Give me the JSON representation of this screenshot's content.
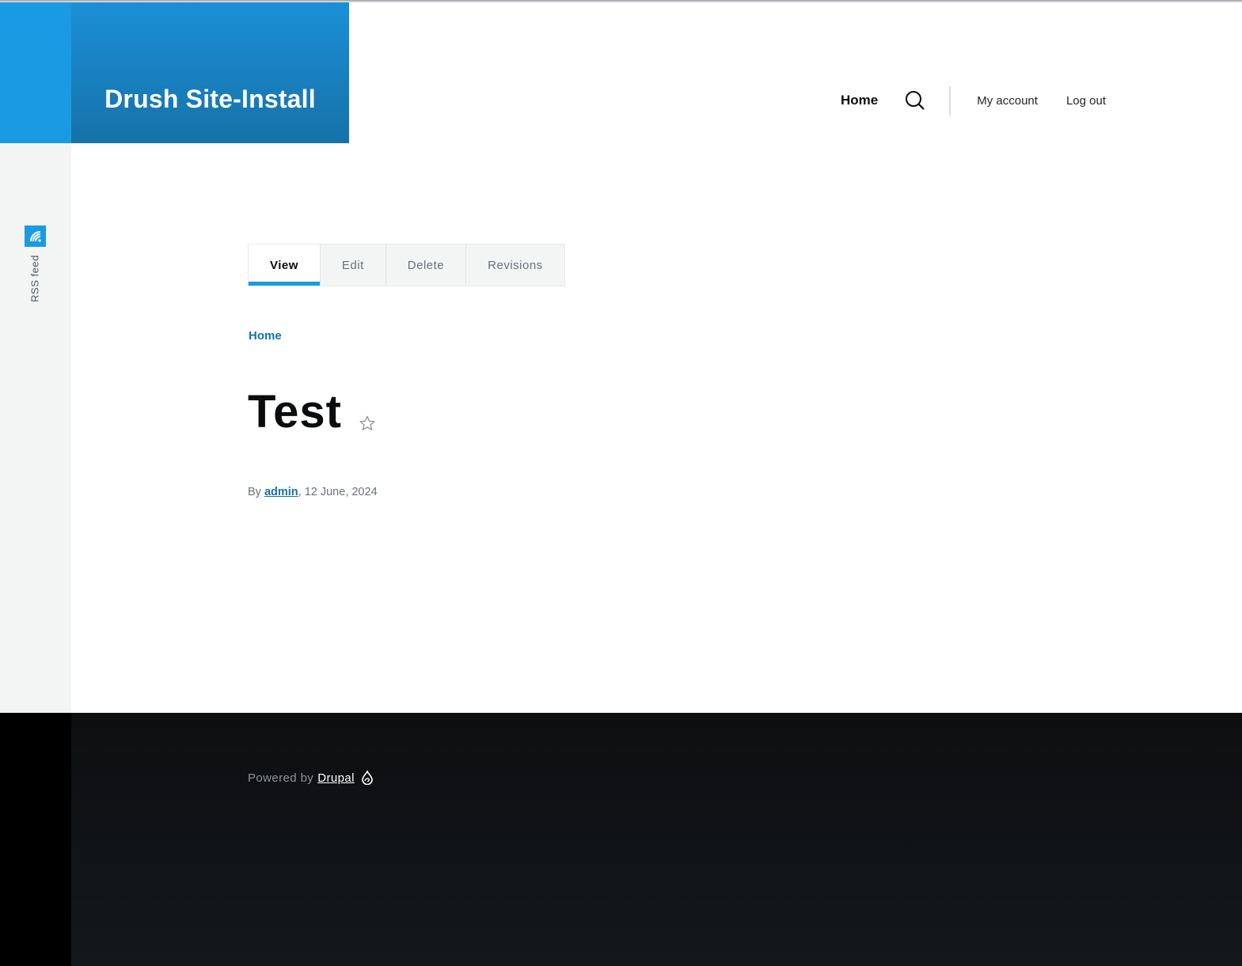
{
  "site": {
    "name": "Drush Site-Install"
  },
  "nav": {
    "home": "Home",
    "my_account": "My account",
    "log_out": "Log out"
  },
  "social": {
    "rss_label": "RSS feed"
  },
  "tabs": [
    {
      "label": "View",
      "active": true
    },
    {
      "label": "Edit",
      "active": false
    },
    {
      "label": "Delete",
      "active": false
    },
    {
      "label": "Revisions",
      "active": false
    }
  ],
  "breadcrumb": {
    "home": "Home"
  },
  "node": {
    "title": "Test",
    "byline_prefix": "By",
    "author": "admin",
    "date": ", 12 June, 2024"
  },
  "footer": {
    "powered_prefix": "Powered by",
    "drupal_link": "Drupal"
  },
  "colors": {
    "accent": "#1b9ae4",
    "brand_dark": "#1672a8",
    "link": "#1472aa",
    "footer_bg": "#14181b"
  }
}
